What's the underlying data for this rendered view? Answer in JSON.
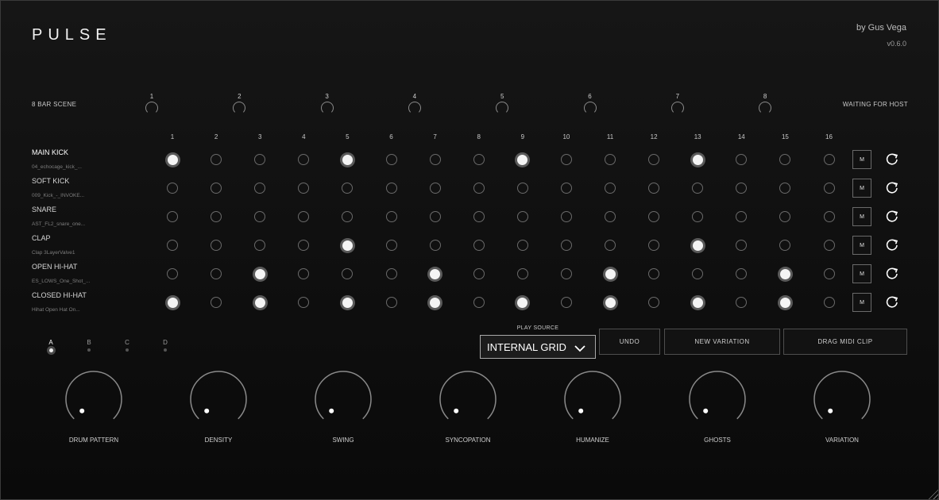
{
  "app": {
    "title": "PULSE",
    "author": "by Gus Vega",
    "version": "v0.6.0"
  },
  "scene": {
    "label": "8 BAR SCENE",
    "bars": [
      "1",
      "2",
      "3",
      "4",
      "5",
      "6",
      "7",
      "8"
    ],
    "status": "WAITING FOR HOST"
  },
  "grid": {
    "step_numbers": [
      "1",
      "2",
      "3",
      "4",
      "5",
      "6",
      "7",
      "8",
      "9",
      "10",
      "11",
      "12",
      "13",
      "14",
      "15",
      "16"
    ],
    "mute_label": "M",
    "tracks": [
      {
        "name": "MAIN KICK",
        "sample": "04_echocage_kick_...",
        "steps": [
          1,
          0,
          0,
          0,
          1,
          0,
          0,
          0,
          1,
          0,
          0,
          0,
          1,
          0,
          0,
          0
        ]
      },
      {
        "name": "SOFT KICK",
        "sample": "009_Kick_-_INVOKE...",
        "steps": [
          0,
          0,
          0,
          0,
          0,
          0,
          0,
          0,
          0,
          0,
          0,
          0,
          0,
          0,
          0,
          0
        ]
      },
      {
        "name": "SNARE",
        "sample": "AST_FL2_snare_one...",
        "steps": [
          0,
          0,
          0,
          0,
          0,
          0,
          0,
          0,
          0,
          0,
          0,
          0,
          0,
          0,
          0,
          0
        ]
      },
      {
        "name": "CLAP",
        "sample": "Clap 3LayerValve1",
        "steps": [
          0,
          0,
          0,
          0,
          1,
          0,
          0,
          0,
          0,
          0,
          0,
          0,
          1,
          0,
          0,
          0
        ]
      },
      {
        "name": "OPEN HI-HAT",
        "sample": "ES_LOWS_One_Shot_...",
        "steps": [
          0,
          0,
          1,
          0,
          0,
          0,
          1,
          0,
          0,
          0,
          1,
          0,
          0,
          0,
          1,
          0
        ]
      },
      {
        "name": "CLOSED HI-HAT",
        "sample": "Hihat Open Hat On...",
        "steps": [
          1,
          0,
          1,
          0,
          1,
          0,
          1,
          0,
          1,
          0,
          1,
          0,
          1,
          0,
          1,
          0
        ]
      }
    ]
  },
  "variations": {
    "tabs": [
      "A",
      "B",
      "C",
      "D"
    ],
    "active": "A"
  },
  "controls": {
    "play_source_label": "PLAY SOURCE",
    "play_source_value": "INTERNAL GRID",
    "undo_label": "UNDO",
    "new_variation_label": "NEW VARIATION",
    "drag_midi_label": "DRAG MIDI CLIP"
  },
  "knobs": [
    {
      "label": "DRUM PATTERN",
      "value": 0
    },
    {
      "label": "DENSITY",
      "value": 0
    },
    {
      "label": "SWING",
      "value": 0
    },
    {
      "label": "SYNCOPATION",
      "value": 0
    },
    {
      "label": "HUMANIZE",
      "value": 0
    },
    {
      "label": "GHOSTS",
      "value": 0
    },
    {
      "label": "VARIATION",
      "value": 0
    }
  ],
  "colors": {
    "background": "#0e0e0e",
    "step_on": "#f4f4f4",
    "step_off_border": "#6a6a6a",
    "accent": "#ffffff"
  }
}
